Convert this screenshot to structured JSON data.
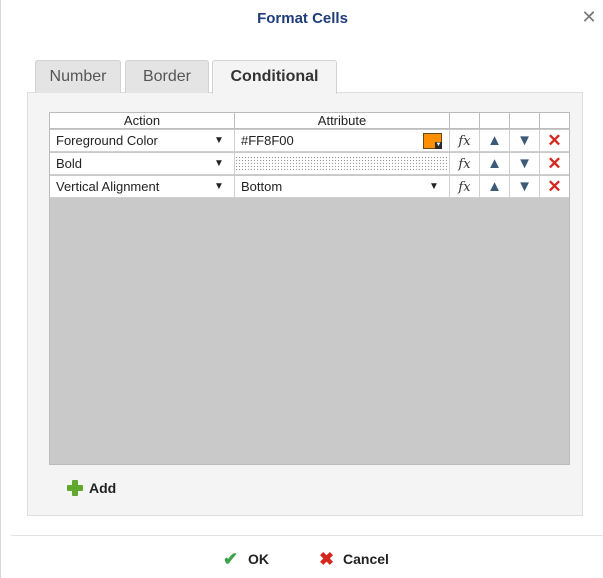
{
  "dialog": {
    "title": "Format Cells",
    "close_glyph": "✕"
  },
  "tabs": [
    {
      "label": "Number",
      "active": false
    },
    {
      "label": "Border",
      "active": false
    },
    {
      "label": "Conditional",
      "active": true
    }
  ],
  "grid": {
    "columns": [
      "Action",
      "Attribute"
    ],
    "rows": [
      {
        "action": "Foreground Color",
        "attribute": "#FF8F00",
        "attribute_type": "color",
        "color": "#FF8F00"
      },
      {
        "action": "Bold",
        "attribute": "",
        "attribute_type": "checkbox-dots"
      },
      {
        "action": "Vertical Alignment",
        "attribute": "Bottom",
        "attribute_type": "dropdown"
      }
    ],
    "row_icons": [
      "fx-icon",
      "move-up-icon",
      "move-down-icon",
      "delete-icon"
    ]
  },
  "icons": {
    "dropdown": "▼",
    "fx": "fx",
    "up": "🡅",
    "down": "🡇",
    "delete": "✕",
    "ok": "✔",
    "cancel": "✖"
  },
  "add_button": {
    "label": "Add"
  },
  "footer": {
    "ok_label": "OK",
    "cancel_label": "Cancel"
  },
  "colors": {
    "accent_title": "#1f3d7a",
    "add_green": "#5fa82e",
    "delete_red": "#d6271e",
    "ok_green": "#3ea34a"
  }
}
